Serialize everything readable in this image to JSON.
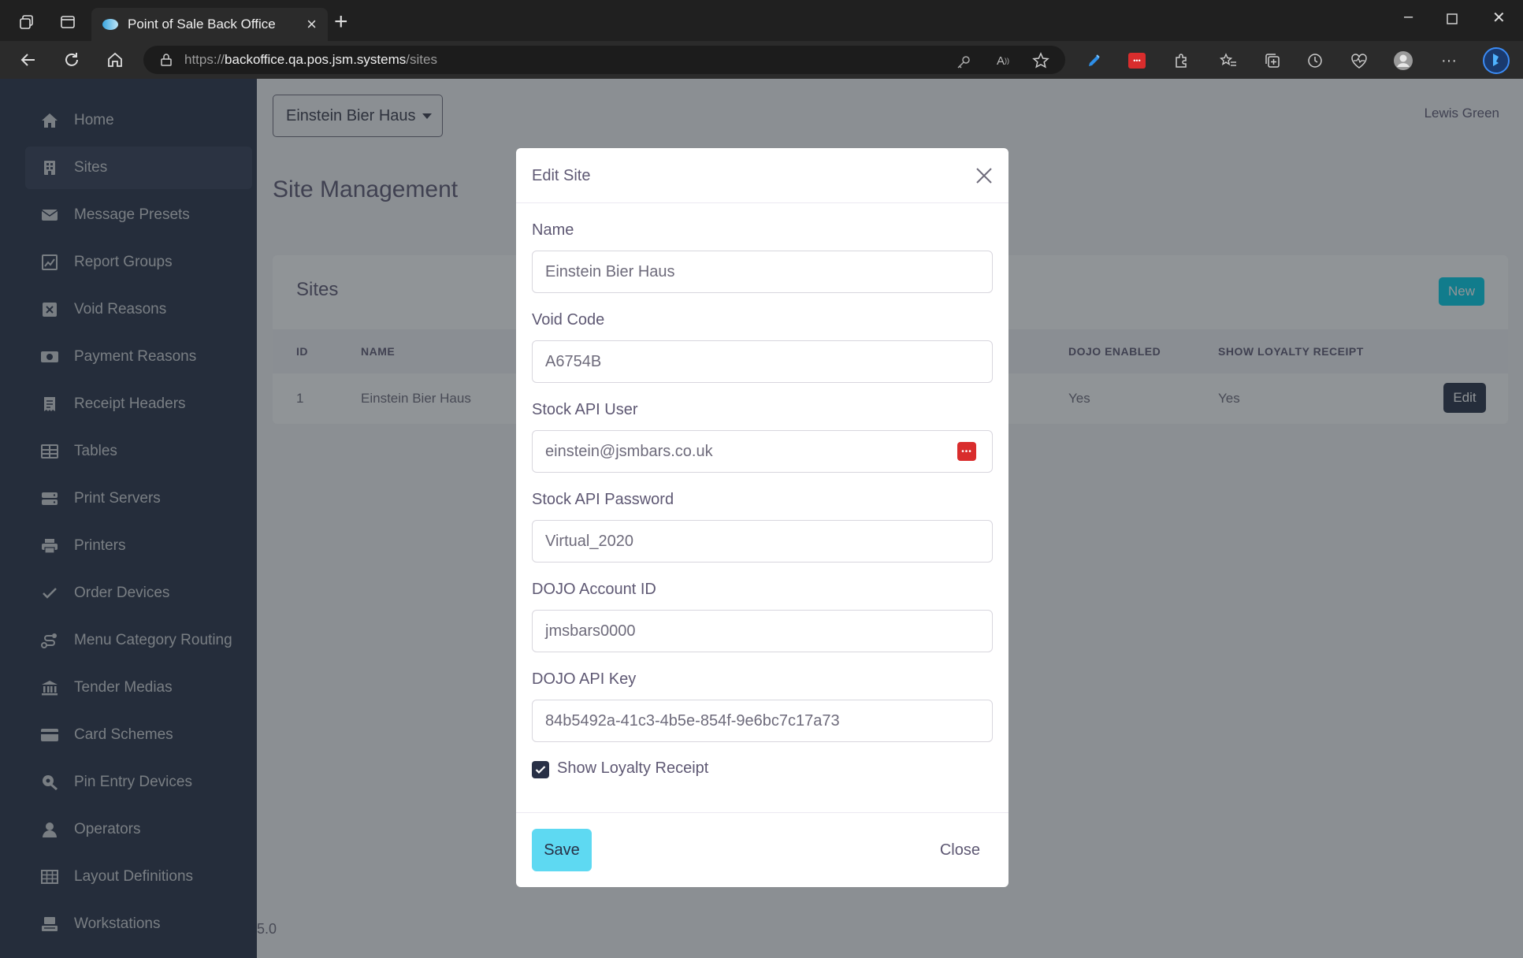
{
  "browser": {
    "tab_title": "Point of Sale Back Office",
    "url_scheme": "https://",
    "url_host": "backoffice.qa.pos.jsm.systems",
    "url_path": "/sites"
  },
  "sidebar": {
    "items": [
      {
        "label": "Home",
        "icon": "home-icon"
      },
      {
        "label": "Sites",
        "icon": "building-icon",
        "active": true
      },
      {
        "label": "Message Presets",
        "icon": "envelope-icon"
      },
      {
        "label": "Report Groups",
        "icon": "chart-icon"
      },
      {
        "label": "Void Reasons",
        "icon": "x-square-icon"
      },
      {
        "label": "Payment Reasons",
        "icon": "money-icon"
      },
      {
        "label": "Receipt Headers",
        "icon": "receipt-icon"
      },
      {
        "label": "Tables",
        "icon": "table-icon"
      },
      {
        "label": "Print Servers",
        "icon": "server-icon"
      },
      {
        "label": "Printers",
        "icon": "printer-icon"
      },
      {
        "label": "Order Devices",
        "icon": "check-icon"
      },
      {
        "label": "Menu Category Routing",
        "icon": "route-icon"
      },
      {
        "label": "Tender Medias",
        "icon": "bank-icon"
      },
      {
        "label": "Card Schemes",
        "icon": "credit-card-icon"
      },
      {
        "label": "Pin Entry Devices",
        "icon": "pin-device-icon"
      },
      {
        "label": "Operators",
        "icon": "user-icon"
      },
      {
        "label": "Layout Definitions",
        "icon": "grid-icon"
      },
      {
        "label": "Workstations",
        "icon": "keyboard-icon"
      }
    ]
  },
  "header": {
    "site_selector": "Einstein Bier Haus",
    "user": "Lewis Green"
  },
  "main": {
    "heading": "Site Management",
    "card_title": "Sites",
    "new_label": "New",
    "columns": [
      "ID",
      "NAME",
      "DOJO ENABLED",
      "SHOW LOYALTY RECEIPT"
    ],
    "rows": [
      {
        "id": "1",
        "name": "Einstein Bier Haus",
        "dojo_enabled": "Yes",
        "show_loyalty_receipt": "Yes",
        "action": "Edit"
      }
    ],
    "version": "5.0"
  },
  "modal": {
    "title": "Edit Site",
    "fields": [
      {
        "label": "Name",
        "value": "Einstein Bier Haus"
      },
      {
        "label": "Void Code",
        "value": "A6754B"
      },
      {
        "label": "Stock API User",
        "value": "einstein@jsmbars.co.uk"
      },
      {
        "label": "Stock API Password",
        "value": "Virtual_2020"
      },
      {
        "label": "DOJO Account ID",
        "value": "jmsbars0000"
      },
      {
        "label": "DOJO API Key",
        "value": "84b5492a-41c3-4b5e-854f-9e6bc7c17a73"
      }
    ],
    "checkbox_label": "Show Loyalty Receipt",
    "checkbox_checked": true,
    "save_label": "Save",
    "close_label": "Close"
  },
  "colors": {
    "sidebar_bg": "#283046",
    "accent": "#00cfe8",
    "save_bg": "#5ed9f2"
  }
}
